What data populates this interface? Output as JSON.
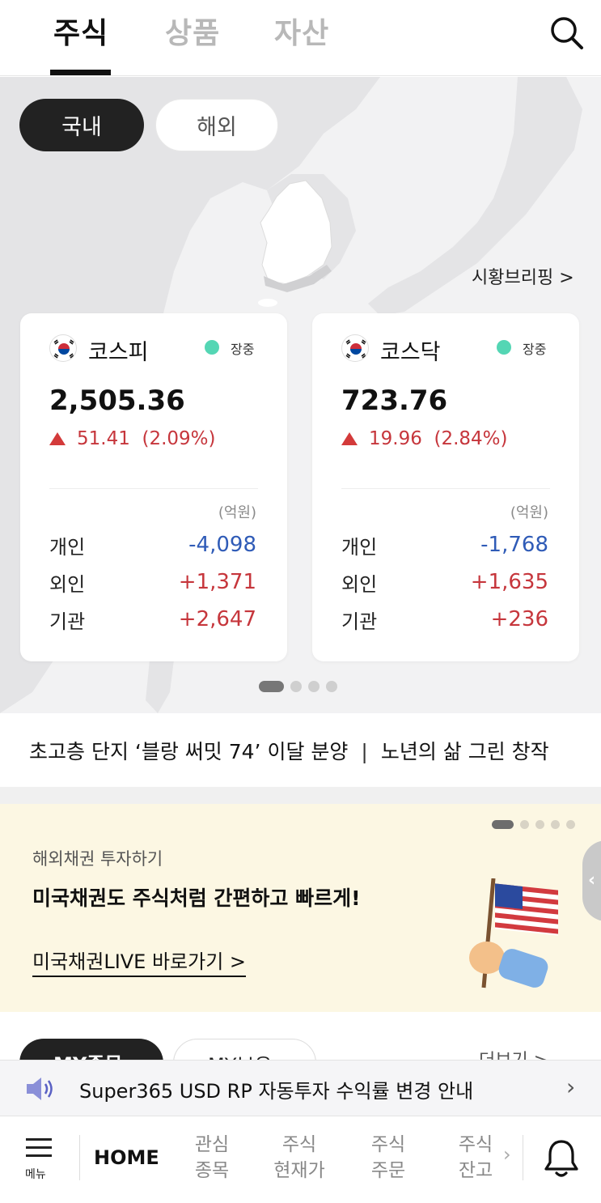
{
  "top_tabs": [
    "주식",
    "상품",
    "자산"
  ],
  "market_toggle": {
    "domestic": "국내",
    "overseas": "해외"
  },
  "briefing_link": "시황브리핑 >",
  "indices": [
    {
      "name": "코스피",
      "status": "장중",
      "value": "2,505.36",
      "change": "51.41",
      "change_pct": "(2.09%)",
      "unit": "(억원)",
      "investors": [
        {
          "label": "개인",
          "value": "-4,098",
          "sign": "neg"
        },
        {
          "label": "외인",
          "value": "+1,371",
          "sign": "pos"
        },
        {
          "label": "기관",
          "value": "+2,647",
          "sign": "pos"
        }
      ]
    },
    {
      "name": "코스닥",
      "status": "장중",
      "value": "723.76",
      "change": "19.96",
      "change_pct": "(2.84%)",
      "unit": "(억원)",
      "investors": [
        {
          "label": "개인",
          "value": "-1,768",
          "sign": "neg"
        },
        {
          "label": "외인",
          "value": "+1,635",
          "sign": "pos"
        },
        {
          "label": "기관",
          "value": "+236",
          "sign": "pos"
        }
      ]
    }
  ],
  "carousel": {
    "pages": 4,
    "active": 0
  },
  "ticker": {
    "item1": "초고층 단지 ‘블랑 써밋 74’ 이달 분양",
    "separator": "|",
    "item2": "노년의 삶 그린 창작"
  },
  "promo": {
    "subtitle": "해외채권 투자하기",
    "title": "미국채권도 주식처럼 간편하고 빠르게!",
    "link": "미국채권LIVE 바로가기 >",
    "pages": 5,
    "active": 0,
    "side_chevron": "‹"
  },
  "my_section": {
    "tab1": "MY종목",
    "tab2": "MY보유",
    "more": "더보기 >"
  },
  "notice": {
    "text": "Super365 USD RP 자동투자 수익률 변경 안내",
    "chevron": "›"
  },
  "bottom_nav": {
    "menu": "메뉴",
    "home": "HOME",
    "items": [
      {
        "line1": "관심",
        "line2": "종목"
      },
      {
        "line1": "주식",
        "line2": "현재가"
      },
      {
        "line1": "주식",
        "line2": "주문"
      },
      {
        "line1": "주식",
        "line2": "잔고"
      }
    ],
    "chevron": "›"
  },
  "colors": {
    "up": "#c6363c",
    "down": "#2f5bb7",
    "live": "#54d6b4",
    "promo_bg": "#fcf7e3"
  }
}
